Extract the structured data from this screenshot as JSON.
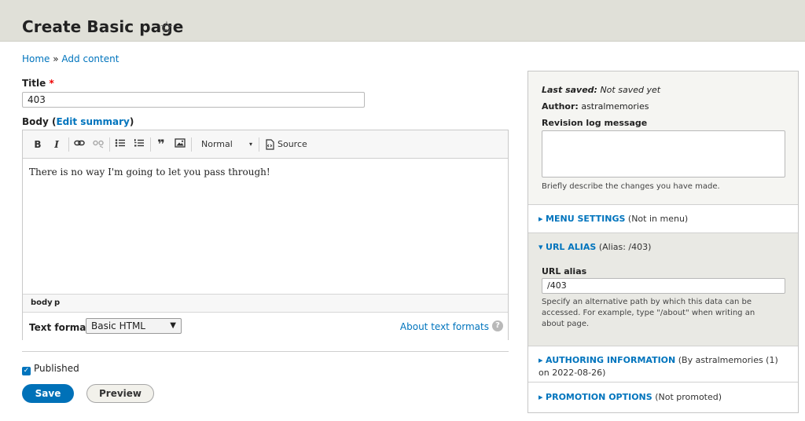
{
  "header": {
    "title": "Create Basic page"
  },
  "breadcrumb": {
    "home": "Home",
    "sep": " » ",
    "current": "Add content"
  },
  "title_field": {
    "label": "Title",
    "required_mark": "*",
    "value": "403"
  },
  "body_field": {
    "label": "Body",
    "paren_open": "(",
    "edit_summary": "Edit summary",
    "paren_close": ")"
  },
  "toolbar": {
    "bold": "B",
    "italic": "I",
    "heading_format": "Normal",
    "source": "Source"
  },
  "editor": {
    "content": "There is no way I'm going to let you pass through!"
  },
  "path": {
    "body": "body",
    "p": "p"
  },
  "text_format": {
    "label": "Text format",
    "selected": "Basic HTML",
    "about_link": "About text formats"
  },
  "published": {
    "label": "Published",
    "checked": true
  },
  "actions": {
    "save": "Save",
    "preview": "Preview"
  },
  "sidebar": {
    "last_saved_label": "Last saved:",
    "last_saved_value": "Not saved yet",
    "author_label": "Author:",
    "author_value": "astralmemories",
    "revision_label": "Revision log message",
    "revision_desc": "Briefly describe the changes you have made.",
    "menu": {
      "title": "MENU SETTINGS",
      "summary": "(Not in menu)"
    },
    "url_alias": {
      "title": "URL ALIAS",
      "summary": "(Alias: /403)",
      "field_label": "URL alias",
      "value": "/403",
      "desc": "Specify an alternative path by which this data can be accessed. For example, type \"/about\" when writing an about page."
    },
    "authoring": {
      "title": "AUTHORING INFORMATION",
      "summary": "(By astralmemories (1) on 2022-08-26)"
    },
    "promotion": {
      "title": "PROMOTION OPTIONS",
      "summary": "(Not promoted)"
    }
  }
}
